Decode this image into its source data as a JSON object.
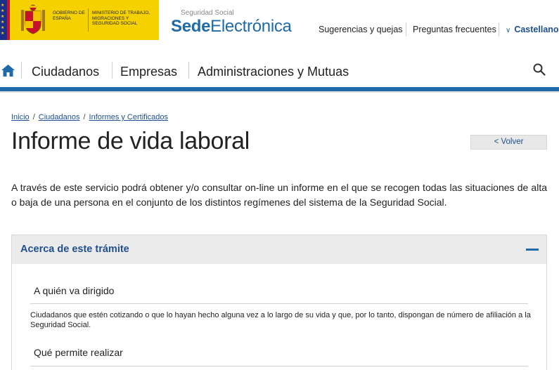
{
  "header": {
    "gov_name": "Gobierno de España",
    "ministry_name": "Ministerio de Trabajo, Migraciones y Seguridad Social",
    "sede_small": "Seguridad Social",
    "sede_bold": "Sede",
    "sede_regular": "Electrónica",
    "links": [
      "Sugerencias y quejas",
      "Preguntas frecuentes"
    ],
    "language": "Castellano"
  },
  "nav": {
    "items": [
      "Ciudadanos",
      "Empresas",
      "Administraciones y Mutuas"
    ]
  },
  "breadcrumb": [
    "Inicio",
    "Ciudadanos",
    "Informes y Certificados"
  ],
  "page": {
    "title": "Informe de vida laboral",
    "back_label": "< Volver",
    "intro": "A través de este servicio podrá obtener y/o consultar on-line un informe en el que se recogen todas las situaciones de alta o baja de una persona en el conjunto de los distintos regímenes del sistema de la Seguridad Social."
  },
  "accordion": {
    "title": "Acerca de este trámite",
    "sections": [
      {
        "title": "A quién va dirigido",
        "text": "Ciudadanos que estén cotizando o que lo hayan hecho alguna vez a lo largo de su vida  y que, por lo tanto, dispongan de número de afiliación a la Seguridad Social."
      },
      {
        "title": "Qué permite realizar"
      }
    ]
  },
  "colors": {
    "brand_blue": "#1f6aa8",
    "link_blue": "#1f4f8f",
    "gov_yellow": "#f6d100",
    "eu_blue": "#1b2f8a",
    "spain_red": "#c8102e"
  },
  "icons": [
    "home-icon",
    "search-icon",
    "chevron-down-icon",
    "minus-icon",
    "coat-of-arms-icon",
    "eu-flag-icon"
  ]
}
